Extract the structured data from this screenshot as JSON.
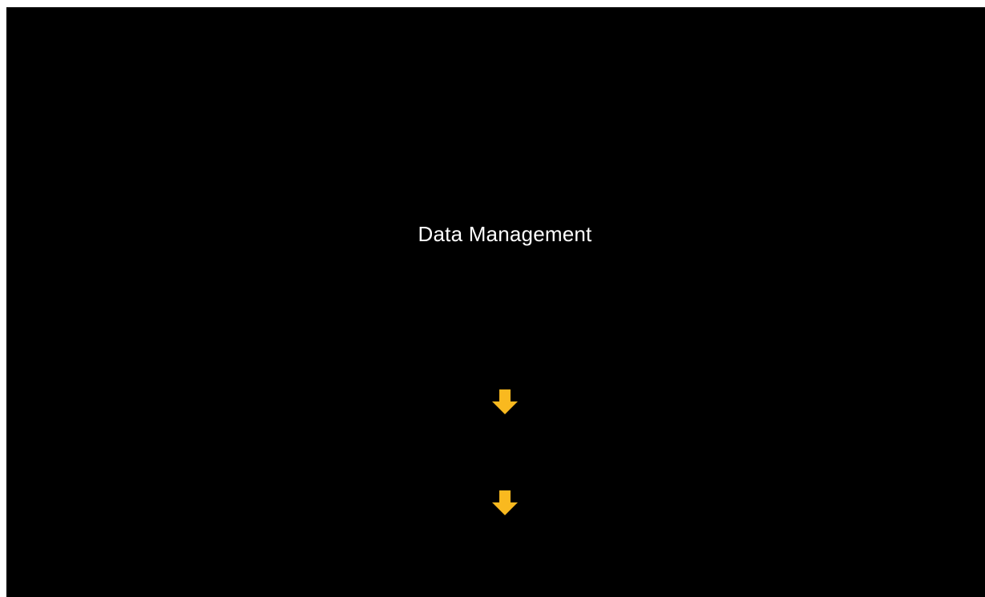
{
  "slide": {
    "title": "Data Management"
  },
  "icons": {
    "arrow_1": "arrow-down-icon",
    "arrow_2": "arrow-down-icon"
  },
  "colors": {
    "background": "#000000",
    "text": "#ffffff",
    "arrow": "#F9B91F"
  }
}
